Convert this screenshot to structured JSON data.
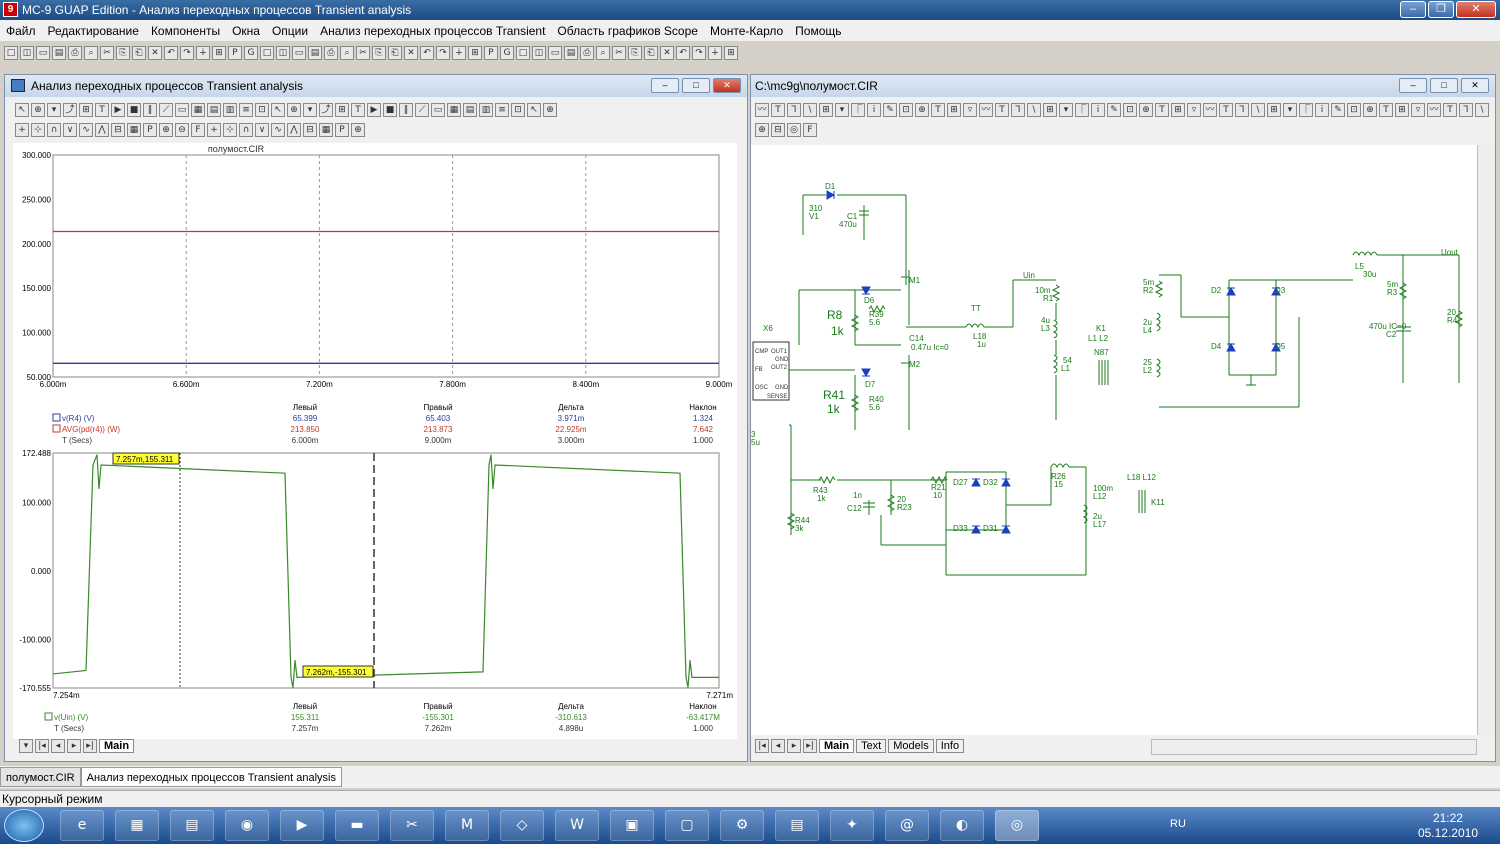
{
  "app": {
    "title": "MC-9 GUAP Edition - Анализ переходных процессов Transient analysis",
    "icon": "app-icon"
  },
  "menu": [
    "Файл",
    "Редактирование",
    "Компоненты",
    "Окна",
    "Опции",
    "Анализ переходных процессов Transient",
    "Область графиков Scope",
    "Монте-Карло",
    "Помощь"
  ],
  "analysis_window": {
    "title": "Анализ переходных процессов Transient analysis",
    "tabs": [
      "Main"
    ]
  },
  "schematic_window": {
    "title": "C:\\mc9g\\полумост.CIR",
    "tabs": [
      "Main",
      "Text",
      "Models",
      "Info"
    ]
  },
  "doc_tabs": [
    "полумост.CIR",
    "Анализ переходных процессов Transient analysis"
  ],
  "status": "Курсорный режим",
  "tray": {
    "lang": "RU",
    "time": "21:22",
    "date": "05.12.2010"
  },
  "colors": {
    "red_trace": "#c0392b",
    "blue_trace": "#2a3f9a",
    "green_trace": "#3a8a2a",
    "schem": "#1a7a1a"
  },
  "chart_data": [
    {
      "type": "line",
      "title": "полумост.CIR",
      "x_ticks": [
        "6.000m",
        "6.600m",
        "7.200m",
        "7.800m",
        "8.400m",
        "9.000m"
      ],
      "y_ticks": [
        "300.000",
        "250.000",
        "200.000",
        "150.000",
        "100.000",
        "50.000"
      ],
      "ylim": [
        50,
        300
      ],
      "xlim": [
        0.006,
        0.009
      ],
      "series": [
        {
          "name": "AVG(pd(r4)) (W)",
          "values": [
            213.85,
            213.873
          ]
        },
        {
          "name": "v(R4) (V)",
          "values": [
            65.399,
            65.403
          ]
        },
        {
          "name": "T (Secs)",
          "values": []
        }
      ],
      "table": {
        "headers": [
          "",
          "Левый",
          "Правый",
          "Дельта",
          "Наклон"
        ],
        "rows": [
          [
            "v(R4) (V)",
            "65.399",
            "65.403",
            "3.971m",
            "1.324"
          ],
          [
            "AVG(pd(r4)) (W)",
            "213.850",
            "213.873",
            "22.925m",
            "7.642"
          ],
          [
            "T (Secs)",
            "6.000m",
            "9.000m",
            "3.000m",
            "1.000"
          ]
        ]
      }
    },
    {
      "type": "line",
      "y_ticks": [
        "172.488",
        "100.000",
        "0.000",
        "-100.000",
        "-170.555"
      ],
      "ylim": [
        -170.555,
        172.488
      ],
      "xlim_labels": [
        "7.254m",
        "7.271m"
      ],
      "series": [
        {
          "name": "v(Uin) (V)",
          "values": []
        },
        {
          "name": "T (Secs)",
          "values": []
        }
      ],
      "cursors": [
        "7.257m,155.311",
        "7.262m,-155.301"
      ],
      "table": {
        "headers": [
          "",
          "Левый",
          "Правый",
          "Дельта",
          "Наклон"
        ],
        "rows": [
          [
            "v(Uin) (V)",
            "155.311",
            "-155.301",
            "-310.613",
            "-63.417M"
          ],
          [
            "T (Secs)",
            "7.257m",
            "7.262m",
            "4.898u",
            "1.000"
          ]
        ]
      }
    }
  ],
  "schematic": {
    "labels": [
      "D1",
      "310",
      "V1",
      "C1",
      "470u",
      "M1",
      "D6",
      "R8",
      "1k",
      "R39",
      "5.6",
      "C14",
      "0.47u Ic=0",
      "TT",
      "L18",
      "1u",
      "Uin",
      "10m",
      "R1",
      "4u",
      "L3",
      "54",
      "L1",
      "K1",
      "L1 L2",
      "N87",
      "X6",
      "CMP",
      "OUT1",
      "GND",
      "OUT2",
      "FB",
      "OSC",
      "SENSE",
      "D7",
      "M2",
      "R41",
      "1k",
      "R40",
      "5.6",
      "5m",
      "R2",
      "2u",
      "L4",
      "25",
      "L2",
      "D2",
      "D3",
      "D4",
      "D5",
      "L5",
      "30u",
      "Uout",
      "5m",
      "R3",
      "470u IC=0",
      "C2",
      "20",
      "R4",
      "R43",
      "1k",
      "1n",
      "C12",
      "20",
      "R23",
      "R21",
      "10",
      "D27",
      "D32",
      "D33",
      "D31",
      "R26",
      "15",
      "100m",
      "L12",
      "2u",
      "L17",
      "L18 L12",
      "K11",
      "R44",
      "3k",
      "3",
      "5u"
    ]
  }
}
